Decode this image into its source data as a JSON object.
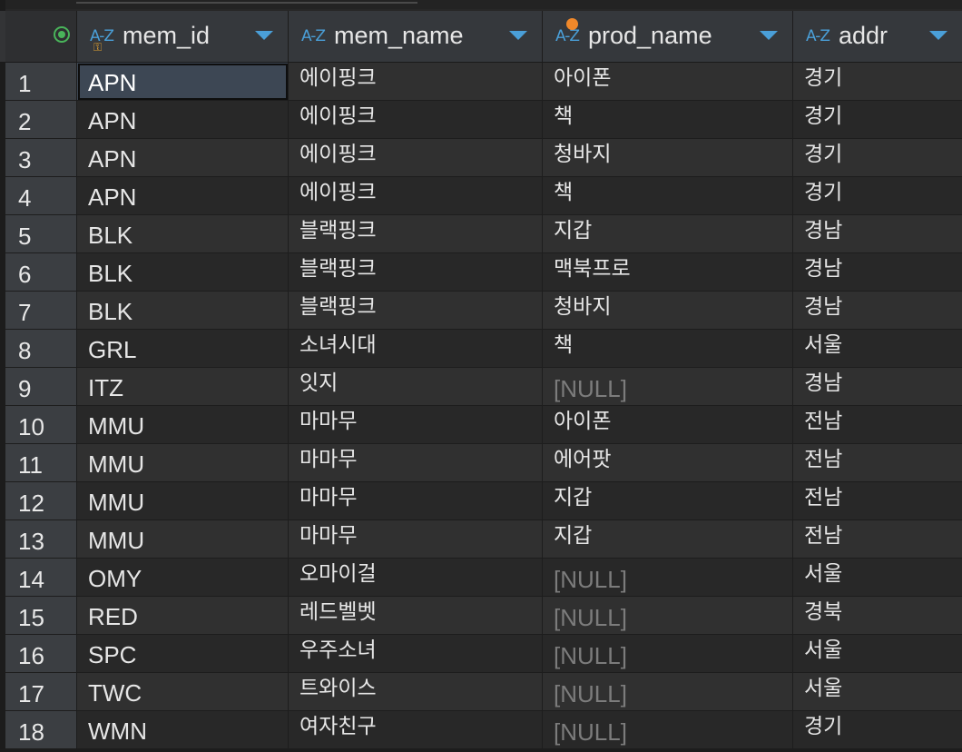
{
  "grid": {
    "columns": [
      {
        "name": "mem_id",
        "type_icon": "text-type-icon",
        "key": true
      },
      {
        "name": "mem_name",
        "type_icon": "text-type-icon"
      },
      {
        "name": "prod_name",
        "type_icon": "text-type-icon",
        "nullable_marker": true
      },
      {
        "name": "addr",
        "type_icon": "text-type-icon"
      }
    ],
    "type_label": "A-Z",
    "null_label": "[NULL]",
    "selected_cell": {
      "row": 1,
      "column": "mem_id"
    },
    "rows": [
      {
        "num": "1",
        "mem_id": "APN",
        "mem_name": "에이핑크",
        "prod_name": "아이폰",
        "addr": "경기"
      },
      {
        "num": "2",
        "mem_id": "APN",
        "mem_name": "에이핑크",
        "prod_name": "책",
        "addr": "경기"
      },
      {
        "num": "3",
        "mem_id": "APN",
        "mem_name": "에이핑크",
        "prod_name": "청바지",
        "addr": "경기"
      },
      {
        "num": "4",
        "mem_id": "APN",
        "mem_name": "에이핑크",
        "prod_name": "책",
        "addr": "경기"
      },
      {
        "num": "5",
        "mem_id": "BLK",
        "mem_name": "블랙핑크",
        "prod_name": "지갑",
        "addr": "경남"
      },
      {
        "num": "6",
        "mem_id": "BLK",
        "mem_name": "블랙핑크",
        "prod_name": "맥북프로",
        "addr": "경남"
      },
      {
        "num": "7",
        "mem_id": "BLK",
        "mem_name": "블랙핑크",
        "prod_name": "청바지",
        "addr": "경남"
      },
      {
        "num": "8",
        "mem_id": "GRL",
        "mem_name": "소녀시대",
        "prod_name": "책",
        "addr": "서울"
      },
      {
        "num": "9",
        "mem_id": "ITZ",
        "mem_name": "잇지",
        "prod_name": null,
        "addr": "경남"
      },
      {
        "num": "10",
        "mem_id": "MMU",
        "mem_name": "마마무",
        "prod_name": "아이폰",
        "addr": "전남"
      },
      {
        "num": "11",
        "mem_id": "MMU",
        "mem_name": "마마무",
        "prod_name": "에어팟",
        "addr": "전남"
      },
      {
        "num": "12",
        "mem_id": "MMU",
        "mem_name": "마마무",
        "prod_name": "지갑",
        "addr": "전남"
      },
      {
        "num": "13",
        "mem_id": "MMU",
        "mem_name": "마마무",
        "prod_name": "지갑",
        "addr": "전남"
      },
      {
        "num": "14",
        "mem_id": "OMY",
        "mem_name": "오마이걸",
        "prod_name": null,
        "addr": "서울"
      },
      {
        "num": "15",
        "mem_id": "RED",
        "mem_name": "레드벨벳",
        "prod_name": null,
        "addr": "경북"
      },
      {
        "num": "16",
        "mem_id": "SPC",
        "mem_name": "우주소녀",
        "prod_name": null,
        "addr": "서울"
      },
      {
        "num": "17",
        "mem_id": "TWC",
        "mem_name": "트와이스",
        "prod_name": null,
        "addr": "서울"
      },
      {
        "num": "18",
        "mem_id": "WMN",
        "mem_name": "여자친구",
        "prod_name": null,
        "addr": "경기"
      }
    ]
  },
  "colors": {
    "type_icon": "#4a9fd8",
    "sort_arrow": "#4a9fd8",
    "record_icon": "#49b45a",
    "key_marker": "#e0a030",
    "nullable_marker": "#f0882a",
    "null_text": "#7c7c7c",
    "selected_bg": "#3d4754"
  }
}
